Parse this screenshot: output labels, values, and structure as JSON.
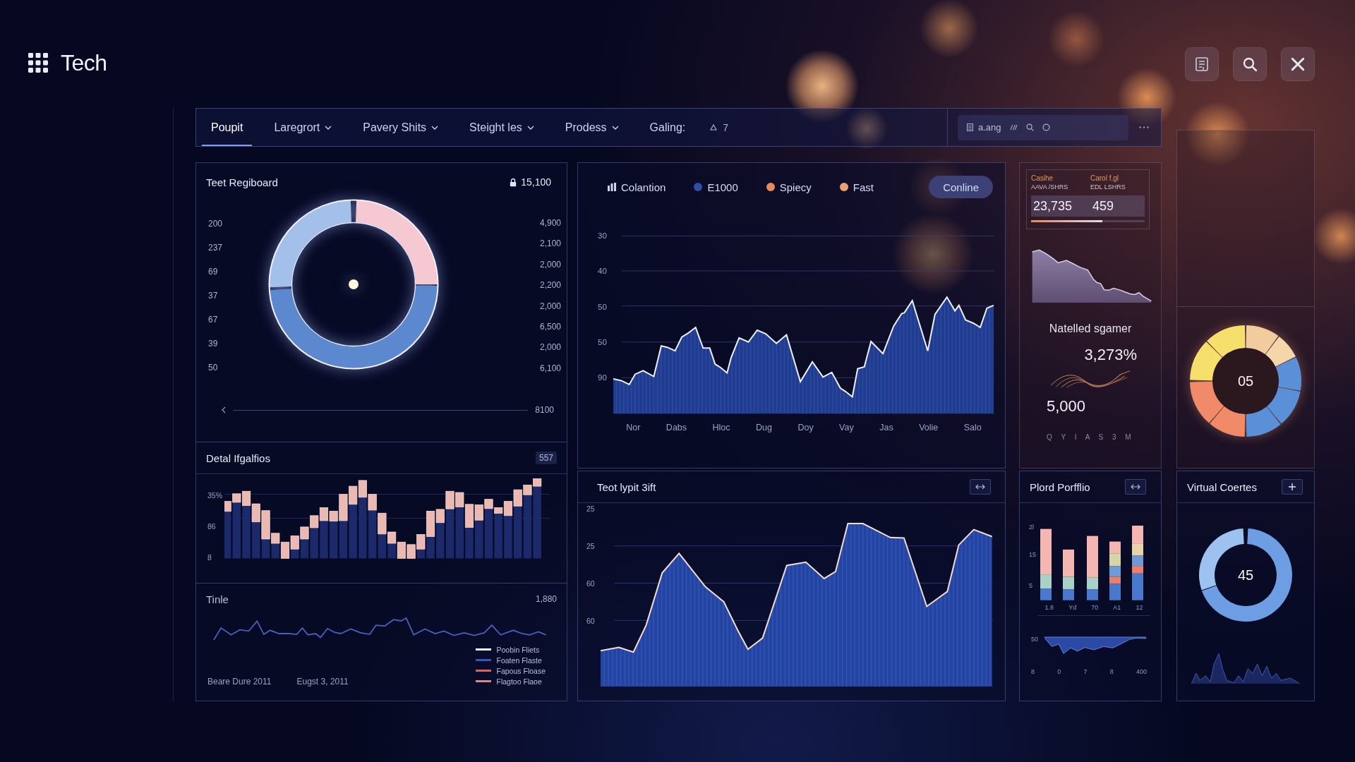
{
  "header": {
    "title": "Tech"
  },
  "nav": {
    "tabs": [
      {
        "label": "Poupit",
        "selected": true,
        "dropdown": false
      },
      {
        "label": "Laregrort",
        "selected": false,
        "dropdown": true
      },
      {
        "label": "Pavery Shits",
        "selected": false,
        "dropdown": true
      },
      {
        "label": "Steight les",
        "selected": false,
        "dropdown": true
      },
      {
        "label": "Prodess",
        "selected": false,
        "dropdown": true
      },
      {
        "label": "Galing:",
        "selected": false,
        "dropdown": false
      }
    ],
    "badge": "7",
    "search": {
      "value": "a.ang"
    }
  },
  "donut_panel": {
    "title": "Teet Regiboard",
    "total": "15,100",
    "left_labels": [
      "200",
      "237",
      "69",
      "37",
      "67",
      "39",
      "50"
    ],
    "right_labels": [
      "4,900",
      "2,100",
      "2,000",
      "2,200",
      "2,000",
      "6,500",
      "2,000",
      "6,100"
    ],
    "axis_label": "8100"
  },
  "bar_panel": {
    "title": "Detal Ifgalfios",
    "badge": "557",
    "y_labels": [
      "35%",
      "86",
      "8"
    ]
  },
  "trend_panel": {
    "title": "Tinle",
    "value": "1,880",
    "legend": [
      {
        "label": "Poobin Fliets",
        "color": "#f4f0f0"
      },
      {
        "label": "Foaten Flaste",
        "color": "#3656b8"
      },
      {
        "label": "Fapous Floase",
        "color": "#d8665c"
      },
      {
        "label": "Flagtoo Flaoe",
        "color": "#d88a7e"
      }
    ],
    "dates": [
      "Beare Dure 2011",
      "Eugst 3, 2011"
    ]
  },
  "main_chart": {
    "legend": [
      {
        "kind": "icon",
        "label": "Colantion"
      },
      {
        "kind": "dot",
        "label": "E1000",
        "color": "#2f4fa6"
      },
      {
        "kind": "dot",
        "label": "Spiecy",
        "color": "#e98a5c"
      },
      {
        "kind": "dot",
        "label": "Fast",
        "color": "#f0a070"
      }
    ],
    "button": "Conline",
    "y_labels": [
      "30",
      "40",
      "50",
      "50",
      "90"
    ],
    "x_labels": [
      "Nor",
      "Dabs",
      "Hloc",
      "Dug",
      "Doy",
      "Vay",
      "Jas",
      "Volie",
      "Salo"
    ]
  },
  "lower_chart": {
    "title": "Teot lypit 3ift",
    "y_labels": [
      "25",
      "25",
      "60",
      "60"
    ]
  },
  "stats": {
    "cards": [
      {
        "label": "Casihe",
        "caption": "AAVA /SHRS",
        "value": "23,735"
      },
      {
        "label": "Carol f.gl",
        "caption": "EDL LSHRS",
        "value": "459"
      }
    ],
    "progress": {
      "level": 0.63
    },
    "metric_title": "Natelled sgamer",
    "percent": "3,273%",
    "amount": "5,000",
    "letters": "Q Y I A S 3 M"
  },
  "portfolio": {
    "title": "Plord Porfflio",
    "y_labels": [
      "2l",
      "15",
      "5"
    ],
    "x_labels": [
      "1.8",
      "Yd",
      "70",
      "A1",
      "12"
    ],
    "wave_label": "50",
    "axis_labels": [
      "8",
      "0",
      "7",
      "8",
      "400"
    ]
  },
  "gauge": {
    "value": "05"
  },
  "courses": {
    "title": "Virtual Coertes",
    "value": "45"
  }
}
